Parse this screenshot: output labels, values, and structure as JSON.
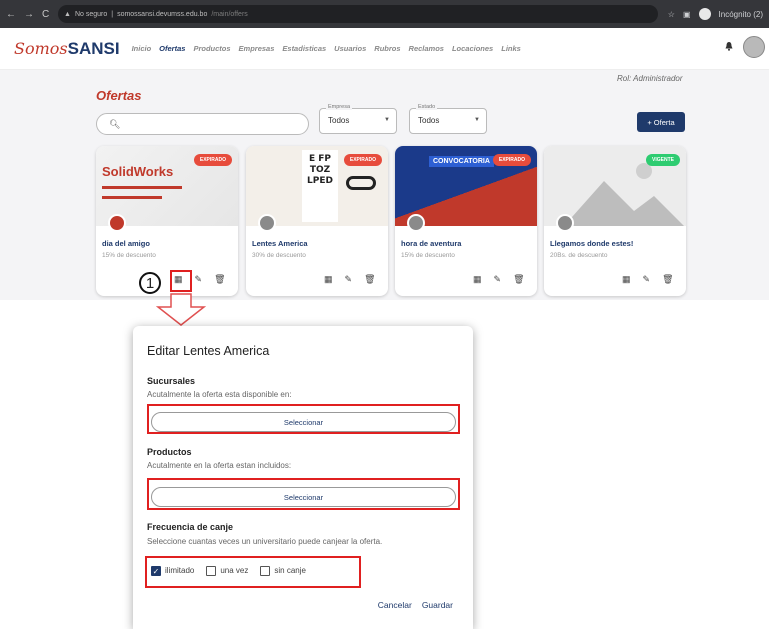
{
  "browser": {
    "security": "No seguro",
    "url_host": "somossansi.devumss.edu.bo",
    "url_path": "/main/offers",
    "profile": "Incógnito (2)"
  },
  "app": {
    "logo_script": "Somos",
    "logo_bold": "SANSI",
    "menu": [
      "Inicio",
      "Ofertas",
      "Productos",
      "Empresas",
      "Estadisticas",
      "Usuarios",
      "Rubros",
      "Reclamos",
      "Locaciones",
      "Links"
    ],
    "active_menu": "Ofertas"
  },
  "page": {
    "role": "Rol: Administrador",
    "title": "Ofertas",
    "filters": [
      {
        "label": "Empresa",
        "value": "Todos"
      },
      {
        "label": "Estado",
        "value": "Todos"
      }
    ],
    "add_button": "+ Oferta"
  },
  "cards": [
    {
      "name": "dia del amigo",
      "desc": "15% de descuento",
      "badge": "EXPIRADO",
      "badge_color": "#e74c3c",
      "image_text": "SolidWorks"
    },
    {
      "name": "Lentes America",
      "desc": "30% de descuento",
      "badge": "EXPIRADO",
      "badge_color": "#e74c3c",
      "image_text": "E FP TOZ LPED"
    },
    {
      "name": "hora de aventura",
      "desc": "15% de descuento",
      "badge": "EXPIRADO",
      "badge_color": "#e74c3c",
      "image_text": "CONVOCATORIA"
    },
    {
      "name": "Llegamos donde estes!",
      "desc": "20Bs. de descuento",
      "badge": "VIGENTE",
      "badge_color": "#2ecc71",
      "image_text": ""
    }
  ],
  "annotation": {
    "number": "1"
  },
  "dialog": {
    "title": "Editar Lentes America",
    "sucursales_title": "Sucursales",
    "sucursales_sub": "Acutalmente la oferta esta disponible en:",
    "sucursales_btn": "Seleccionar",
    "productos_title": "Productos",
    "productos_sub": "Acutalmente en la oferta estan incluidos:",
    "productos_btn": "Seleccionar",
    "frecuencia_title": "Frecuencia de canje",
    "frecuencia_sub": "Seleccione cuantas veces un universitario puede canjear la oferta.",
    "options": [
      {
        "label": "ilimitado",
        "checked": true
      },
      {
        "label": "una vez",
        "checked": false
      },
      {
        "label": "sin canje",
        "checked": false
      }
    ],
    "cancel": "Cancelar",
    "save": "Guardar"
  }
}
